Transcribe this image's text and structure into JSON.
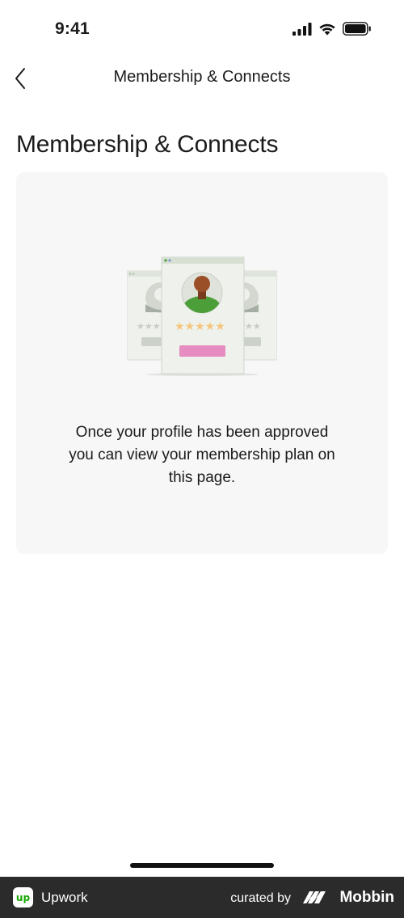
{
  "status_bar": {
    "time": "9:41",
    "icons": [
      "cellular-signal-icon",
      "wifi-icon",
      "battery-icon"
    ]
  },
  "nav": {
    "back_icon": "chevron-left-icon",
    "title": "Membership & Connects"
  },
  "page": {
    "title": "Membership & Connects"
  },
  "empty_state": {
    "illustration": "profile-cards-illustration",
    "message": "Once your profile has been approved you can view your membership plan on this page.",
    "colors": {
      "card_background": "#f7f7f7",
      "avatar_green": "#4c9f38",
      "avatar_head": "#9a4f28",
      "stars": "#f5c57c",
      "button_pink": "#e68cc0"
    }
  },
  "footer": {
    "app_name": "Upwork",
    "logo_text": "up",
    "curated_label": "curated by",
    "brand": "Mobbin"
  }
}
